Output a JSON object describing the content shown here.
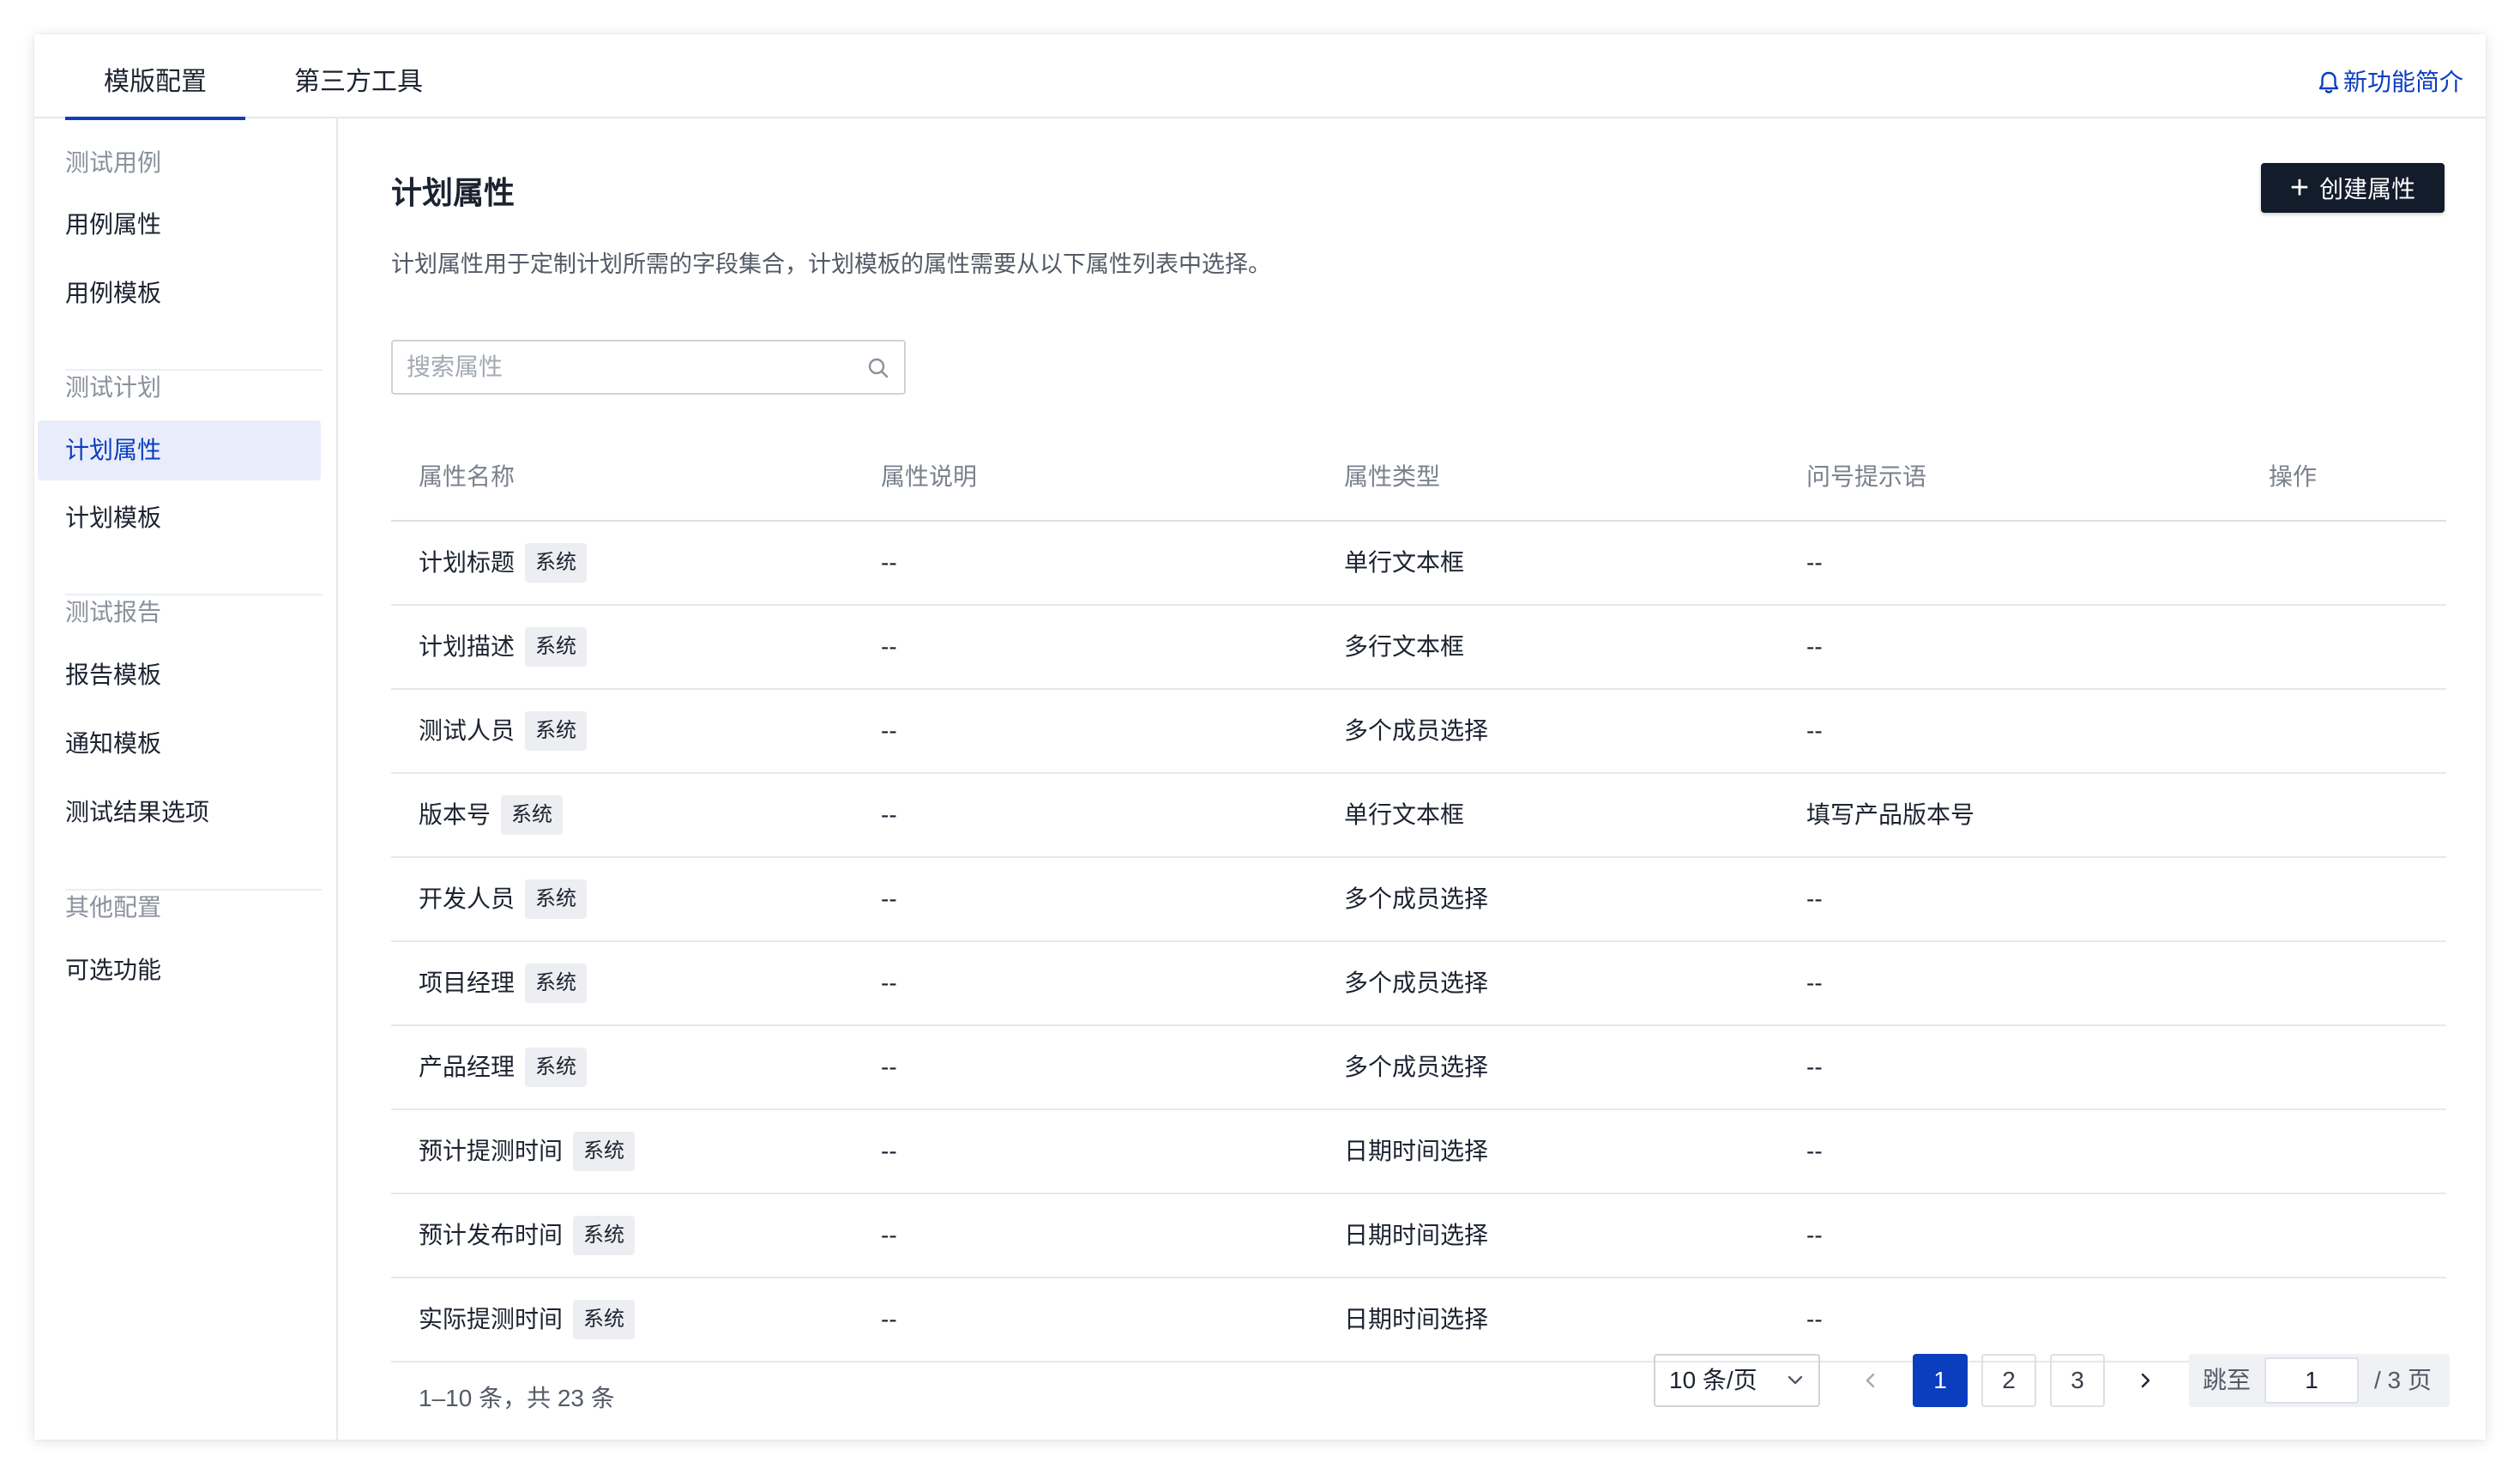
{
  "tabs": [
    {
      "label": "模版配置",
      "active": true
    },
    {
      "label": "第三方工具",
      "active": false
    }
  ],
  "whats_new": {
    "label": "新功能简介",
    "icon": "bell-icon"
  },
  "sidebar": {
    "groups": [
      {
        "title": "测试用例",
        "items": [
          "用例属性",
          "用例模板"
        ]
      },
      {
        "title": "测试计划",
        "items": [
          "计划属性",
          "计划模板"
        ]
      },
      {
        "title": "测试报告",
        "items": [
          "报告模板",
          "通知模板",
          "测试结果选项"
        ]
      },
      {
        "title": "其他配置",
        "items": [
          "可选功能"
        ]
      }
    ],
    "active_item": "计划属性"
  },
  "main": {
    "title": "计划属性",
    "create_button": "创建属性",
    "description": "计划属性用于定制计划所需的字段集合，计划模板的属性需要从以下属性列表中选择。",
    "search_placeholder": "搜索属性"
  },
  "table": {
    "columns": [
      "属性名称",
      "属性说明",
      "属性类型",
      "问号提示语",
      "操作"
    ],
    "rows": [
      {
        "name": "计划标题",
        "tag": "系统",
        "desc": "--",
        "type": "单行文本框",
        "hint": "--",
        "action": ""
      },
      {
        "name": "计划描述",
        "tag": "系统",
        "desc": "--",
        "type": "多行文本框",
        "hint": "--",
        "action": ""
      },
      {
        "name": "测试人员",
        "tag": "系统",
        "desc": "--",
        "type": "多个成员选择",
        "hint": "--",
        "action": ""
      },
      {
        "name": "版本号",
        "tag": "系统",
        "desc": "--",
        "type": "单行文本框",
        "hint": "填写产品版本号",
        "action": ""
      },
      {
        "name": "开发人员",
        "tag": "系统",
        "desc": "--",
        "type": "多个成员选择",
        "hint": "--",
        "action": ""
      },
      {
        "name": "项目经理",
        "tag": "系统",
        "desc": "--",
        "type": "多个成员选择",
        "hint": "--",
        "action": ""
      },
      {
        "name": "产品经理",
        "tag": "系统",
        "desc": "--",
        "type": "多个成员选择",
        "hint": "--",
        "action": ""
      },
      {
        "name": "预计提测时间",
        "tag": "系统",
        "desc": "--",
        "type": "日期时间选择",
        "hint": "--",
        "action": ""
      },
      {
        "name": "预计发布时间",
        "tag": "系统",
        "desc": "--",
        "type": "日期时间选择",
        "hint": "--",
        "action": ""
      },
      {
        "name": "实际提测时间",
        "tag": "系统",
        "desc": "--",
        "type": "日期时间选择",
        "hint": "--",
        "action": ""
      }
    ]
  },
  "pagination": {
    "total_text": "1–10 条，共 23 条",
    "page_size": "10 条/页",
    "pages": [
      "1",
      "2",
      "3"
    ],
    "current_page": "1",
    "jump_label": "跳至",
    "jump_value": "1",
    "total_pages_text": "/ 3 页"
  },
  "colors": {
    "accent": "#0b3dbf",
    "primary_button": "#131c2b",
    "active_sidebar_bg": "#e9edfb"
  }
}
